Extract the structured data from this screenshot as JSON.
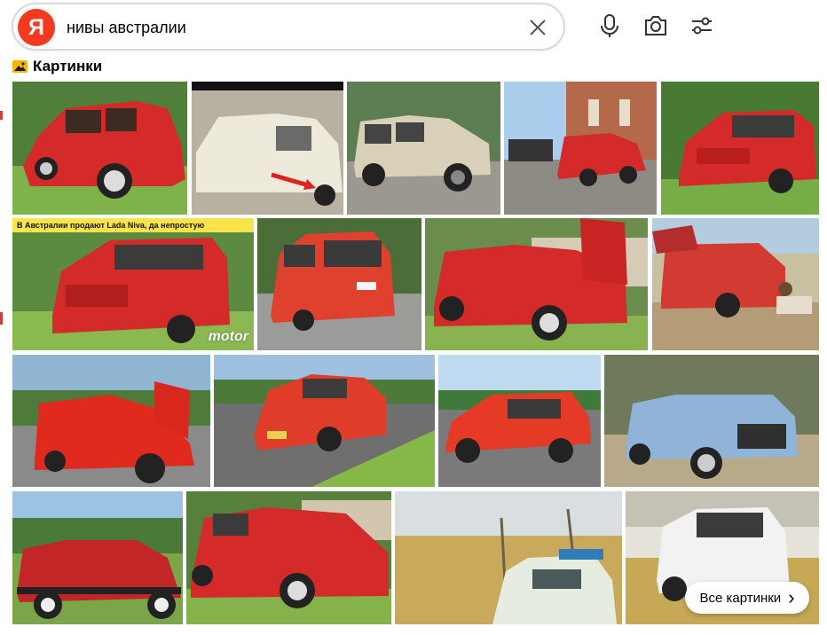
{
  "search": {
    "logo_letter": "Я",
    "query": "нивы австралии"
  },
  "section": {
    "title": "Картинки"
  },
  "tiles": [
    {
      "caption": "",
      "watermark": ""
    },
    {
      "caption": "",
      "watermark": ""
    },
    {
      "caption": "",
      "watermark": ""
    },
    {
      "caption": "",
      "watermark": ""
    },
    {
      "caption": "",
      "watermark": ""
    },
    {
      "caption": "В Австралии продают Lada Niva, да непростую",
      "watermark": "motor"
    },
    {
      "caption": "",
      "watermark": ""
    },
    {
      "caption": "",
      "watermark": ""
    },
    {
      "caption": "",
      "watermark": ""
    },
    {
      "caption": "",
      "watermark": ""
    },
    {
      "caption": "",
      "watermark": ""
    },
    {
      "caption": "",
      "watermark": ""
    },
    {
      "caption": "",
      "watermark": ""
    },
    {
      "caption": "",
      "watermark": ""
    },
    {
      "caption": "",
      "watermark": ""
    },
    {
      "caption": "",
      "watermark": ""
    },
    {
      "caption": "",
      "watermark": ""
    }
  ],
  "all_images_button": {
    "label": "Все картинки",
    "arrow": "›"
  },
  "colors": {
    "brand": "#f5391e",
    "car_red": "#d42a2a",
    "car_beige": "#d8d0b8",
    "car_blue": "#8fb4d8",
    "car_white": "#f2f2f2",
    "grass": "#6da83b",
    "sky": "#a9cdea"
  }
}
